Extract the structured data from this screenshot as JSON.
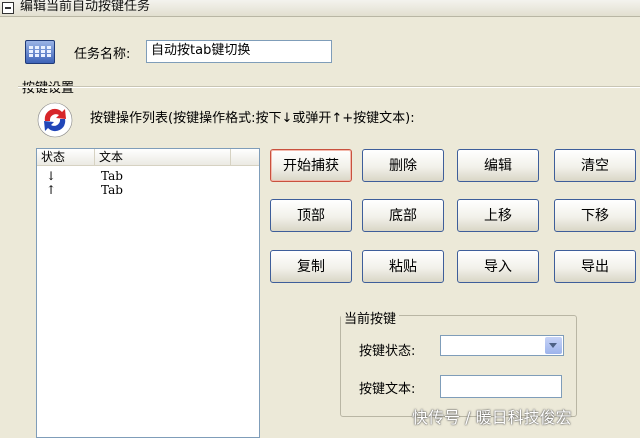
{
  "window": {
    "title": "编辑当前自动按键任务"
  },
  "task": {
    "name_label": "任务名称:",
    "name_value": "自动按tab键切换"
  },
  "keys_group": {
    "title": "按键设置",
    "list_caption": "按键操作列表(按键操作格式:按下↓或弹开↑+按键文本):"
  },
  "list": {
    "columns": [
      "状态",
      "文本"
    ],
    "rows": [
      {
        "state": "↓",
        "text": "Tab"
      },
      {
        "state": "↑",
        "text": "Tab"
      }
    ]
  },
  "buttons": {
    "start_capture": "开始捕获",
    "delete": "删除",
    "edit": "编辑",
    "clear": "清空",
    "top": "顶部",
    "bottom": "底部",
    "move_up": "上移",
    "move_down": "下移",
    "copy": "复制",
    "paste": "粘贴",
    "import": "导入",
    "export": "导出"
  },
  "current_key": {
    "title": "当前按键",
    "state_label": "按键状态:",
    "state_value": "",
    "text_label": "按键文本:",
    "text_value": ""
  },
  "watermark": "快传号 / 暖日科技俊宏",
  "colors": {
    "window_bg": "#ECE9D8",
    "button_border": "#3E5E9A",
    "active_button_border": "#C9513E"
  }
}
